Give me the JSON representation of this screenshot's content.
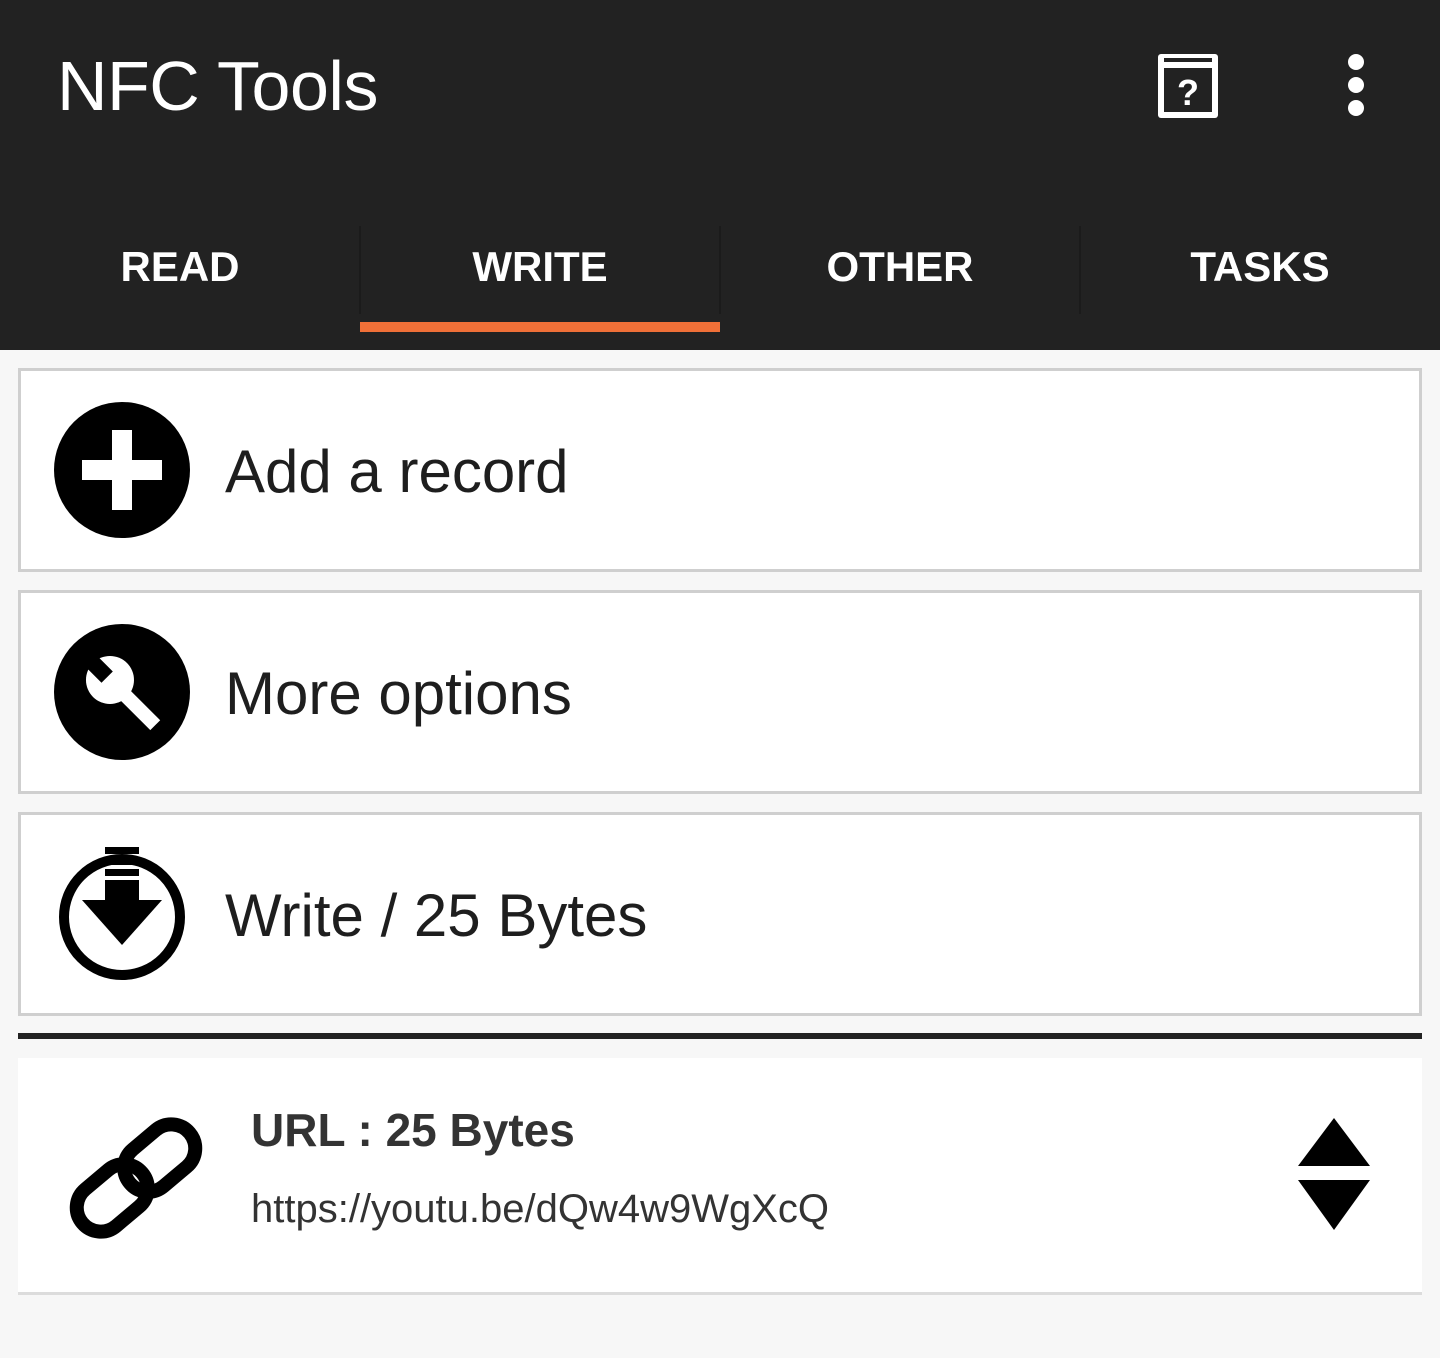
{
  "app": {
    "title": "NFC Tools",
    "help_icon": "help-book-icon",
    "overflow_icon": "more-vert-icon"
  },
  "tabs": [
    {
      "label": "READ",
      "selected": false
    },
    {
      "label": "WRITE",
      "selected": true
    },
    {
      "label": "OTHER",
      "selected": false
    },
    {
      "label": "TASKS",
      "selected": false
    }
  ],
  "actions": [
    {
      "label": "Add a record",
      "icon": "add-circle-icon"
    },
    {
      "label": "More options",
      "icon": "wrench-circle-icon"
    },
    {
      "label": "Write / 25 Bytes",
      "icon": "write-download-icon"
    }
  ],
  "records": [
    {
      "title": "URL : 25 Bytes",
      "value": "https://youtu.be/dQw4w9WgXcQ",
      "icon": "link-icon",
      "reorder_icon": "reorder-updown-icon"
    }
  ],
  "colors": {
    "appbar": "#222222",
    "accent": "#f07038",
    "background": "#f7f7f7",
    "card_border": "#cfcfcf"
  }
}
